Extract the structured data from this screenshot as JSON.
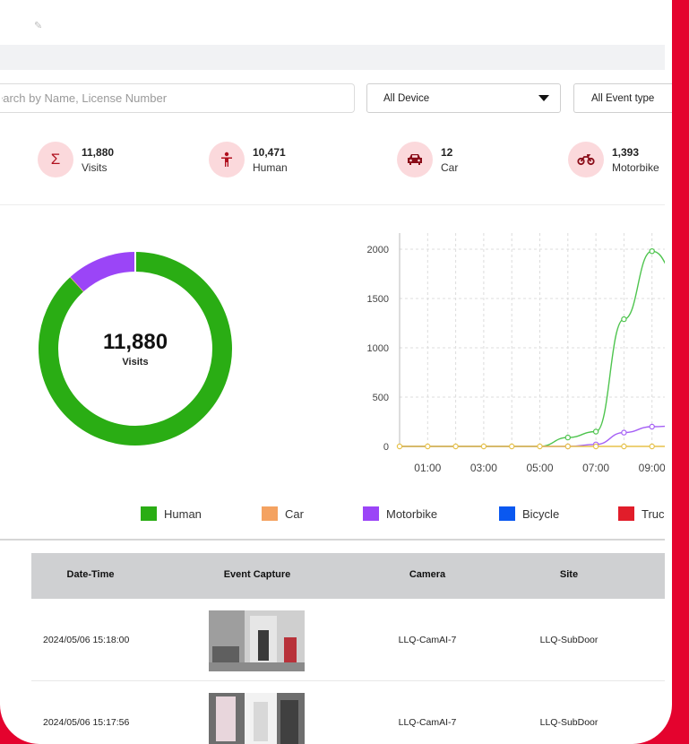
{
  "search": {
    "placeholder": "earch by Name, License Number"
  },
  "filters": {
    "device": "All Device",
    "event_type": "All Event type"
  },
  "stats": [
    {
      "value": "11,880",
      "label": "Visits",
      "icon": "sigma-icon",
      "glyph": "Σ"
    },
    {
      "value": "10,471",
      "label": "Human",
      "icon": "person-icon",
      "glyph": "🯅"
    },
    {
      "value": "12",
      "label": "Car",
      "icon": "car-icon",
      "glyph": "🚗"
    },
    {
      "value": "1,393",
      "label": "Motorbike",
      "icon": "motorbike-icon",
      "glyph": "🏍"
    }
  ],
  "donut": {
    "total": "11,880",
    "label": "Visits",
    "segments": [
      {
        "name": "Human",
        "value": 10471,
        "color": "#2aad14"
      },
      {
        "name": "Car",
        "value": 12,
        "color": "#f4a261"
      },
      {
        "name": "Motorbike",
        "value": 1393,
        "color": "#9b45f7"
      }
    ]
  },
  "chart_data": {
    "type": "line",
    "x": [
      "00:00",
      "01:00",
      "02:00",
      "03:00",
      "04:00",
      "05:00",
      "06:00",
      "07:00",
      "08:00",
      "09:00",
      "10:00"
    ],
    "x_tick_labels": [
      "01:00",
      "03:00",
      "05:00",
      "07:00",
      "09:00"
    ],
    "y_ticks": [
      0,
      500,
      1000,
      1500,
      2000
    ],
    "ylim": [
      0,
      2200
    ],
    "grid": true,
    "series": [
      {
        "name": "Human",
        "color": "#4ec44e",
        "values": [
          0,
          0,
          0,
          0,
          0,
          0,
          90,
          150,
          1290,
          1980,
          1700
        ]
      },
      {
        "name": "Motorbike",
        "color": "#a560f5",
        "values": [
          0,
          0,
          0,
          0,
          0,
          0,
          0,
          20,
          140,
          200,
          210
        ]
      },
      {
        "name": "Car",
        "color": "#e7c24a",
        "values": [
          0,
          0,
          0,
          0,
          0,
          0,
          0,
          0,
          0,
          0,
          0
        ]
      }
    ]
  },
  "legend": [
    {
      "name": "Human",
      "color": "#2aad14"
    },
    {
      "name": "Car",
      "color": "#f4a261"
    },
    {
      "name": "Motorbike",
      "color": "#9b45f7"
    },
    {
      "name": "Bicycle",
      "color": "#0a58f0"
    },
    {
      "name": "Truc",
      "color": "#e11d2a"
    }
  ],
  "table": {
    "headers": [
      "Date-Time",
      "Event Capture",
      "Camera",
      "Site"
    ],
    "rows": [
      {
        "datetime": "2024/05/06 15:18:00",
        "camera": "LLQ-CamAI-7",
        "site": "LLQ-SubDoor"
      },
      {
        "datetime": "2024/05/06 15:17:56",
        "camera": "LLQ-CamAI-7",
        "site": "LLQ-SubDoor"
      }
    ]
  }
}
